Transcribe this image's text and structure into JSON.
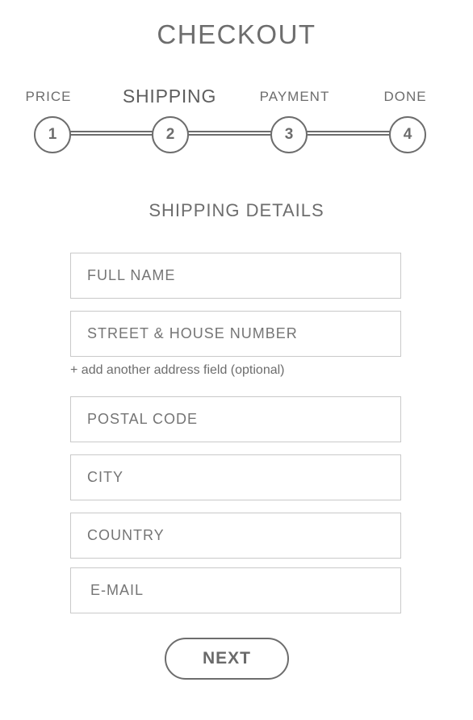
{
  "header": {
    "title": "CHECKOUT"
  },
  "steps": [
    {
      "label": "PRICE",
      "number": "1",
      "active": false
    },
    {
      "label": "SHIPPING",
      "number": "2",
      "active": true
    },
    {
      "label": "PAYMENT",
      "number": "3",
      "active": false
    },
    {
      "label": "DONE",
      "number": "4",
      "active": false
    }
  ],
  "form": {
    "section_title": "SHIPPING DETAILS",
    "full_name": {
      "placeholder": "FULL NAME",
      "value": ""
    },
    "street": {
      "placeholder": "STREET & HOUSE NUMBER",
      "value": ""
    },
    "add_address_link": "+ add another address field (optional)",
    "postal_code": {
      "placeholder": "POSTAL CODE",
      "value": ""
    },
    "city": {
      "placeholder": "CITY",
      "value": ""
    },
    "country": {
      "placeholder": "COUNTRY",
      "value": ""
    },
    "email": {
      "placeholder": "E-MAIL",
      "value": ""
    },
    "next_label": "NEXT"
  },
  "colors": {
    "text": "#6d6d6d",
    "border": "#c9c9c9",
    "background": "#ffffff"
  }
}
